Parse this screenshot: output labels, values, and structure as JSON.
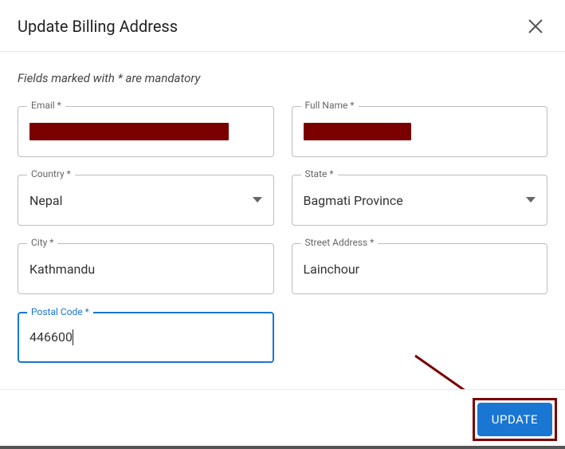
{
  "header": {
    "title": "Update Billing Address"
  },
  "hint": "Fields marked with * are mandatory",
  "fields": {
    "email": {
      "label": "Email *"
    },
    "fullname": {
      "label": "Full Name *"
    },
    "country": {
      "label": "Country *",
      "value": "Nepal"
    },
    "state": {
      "label": "State *",
      "value": "Bagmati Province"
    },
    "city": {
      "label": "City *",
      "value": "Kathmandu"
    },
    "street": {
      "label": "Street Address *",
      "value": "Lainchour"
    },
    "postal": {
      "label": "Postal Code *",
      "value": "446600"
    }
  },
  "footer": {
    "update_label": "UPDATE"
  }
}
